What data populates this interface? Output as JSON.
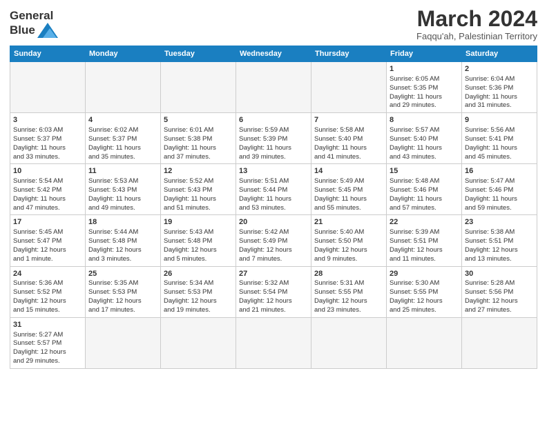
{
  "header": {
    "logo_text_general": "General",
    "logo_text_blue": "Blue",
    "month_title": "March 2024",
    "subtitle": "Faqqu'ah, Palestinian Territory"
  },
  "days_of_week": [
    "Sunday",
    "Monday",
    "Tuesday",
    "Wednesday",
    "Thursday",
    "Friday",
    "Saturday"
  ],
  "weeks": [
    [
      {
        "day": "",
        "info": "",
        "empty": true
      },
      {
        "day": "",
        "info": "",
        "empty": true
      },
      {
        "day": "",
        "info": "",
        "empty": true
      },
      {
        "day": "",
        "info": "",
        "empty": true
      },
      {
        "day": "",
        "info": "",
        "empty": true
      },
      {
        "day": "1",
        "info": "Sunrise: 6:05 AM\nSunset: 5:35 PM\nDaylight: 11 hours\nand 29 minutes.",
        "empty": false
      },
      {
        "day": "2",
        "info": "Sunrise: 6:04 AM\nSunset: 5:36 PM\nDaylight: 11 hours\nand 31 minutes.",
        "empty": false
      }
    ],
    [
      {
        "day": "3",
        "info": "Sunrise: 6:03 AM\nSunset: 5:37 PM\nDaylight: 11 hours\nand 33 minutes.",
        "empty": false
      },
      {
        "day": "4",
        "info": "Sunrise: 6:02 AM\nSunset: 5:37 PM\nDaylight: 11 hours\nand 35 minutes.",
        "empty": false
      },
      {
        "day": "5",
        "info": "Sunrise: 6:01 AM\nSunset: 5:38 PM\nDaylight: 11 hours\nand 37 minutes.",
        "empty": false
      },
      {
        "day": "6",
        "info": "Sunrise: 5:59 AM\nSunset: 5:39 PM\nDaylight: 11 hours\nand 39 minutes.",
        "empty": false
      },
      {
        "day": "7",
        "info": "Sunrise: 5:58 AM\nSunset: 5:40 PM\nDaylight: 11 hours\nand 41 minutes.",
        "empty": false
      },
      {
        "day": "8",
        "info": "Sunrise: 5:57 AM\nSunset: 5:40 PM\nDaylight: 11 hours\nand 43 minutes.",
        "empty": false
      },
      {
        "day": "9",
        "info": "Sunrise: 5:56 AM\nSunset: 5:41 PM\nDaylight: 11 hours\nand 45 minutes.",
        "empty": false
      }
    ],
    [
      {
        "day": "10",
        "info": "Sunrise: 5:54 AM\nSunset: 5:42 PM\nDaylight: 11 hours\nand 47 minutes.",
        "empty": false
      },
      {
        "day": "11",
        "info": "Sunrise: 5:53 AM\nSunset: 5:43 PM\nDaylight: 11 hours\nand 49 minutes.",
        "empty": false
      },
      {
        "day": "12",
        "info": "Sunrise: 5:52 AM\nSunset: 5:43 PM\nDaylight: 11 hours\nand 51 minutes.",
        "empty": false
      },
      {
        "day": "13",
        "info": "Sunrise: 5:51 AM\nSunset: 5:44 PM\nDaylight: 11 hours\nand 53 minutes.",
        "empty": false
      },
      {
        "day": "14",
        "info": "Sunrise: 5:49 AM\nSunset: 5:45 PM\nDaylight: 11 hours\nand 55 minutes.",
        "empty": false
      },
      {
        "day": "15",
        "info": "Sunrise: 5:48 AM\nSunset: 5:46 PM\nDaylight: 11 hours\nand 57 minutes.",
        "empty": false
      },
      {
        "day": "16",
        "info": "Sunrise: 5:47 AM\nSunset: 5:46 PM\nDaylight: 11 hours\nand 59 minutes.",
        "empty": false
      }
    ],
    [
      {
        "day": "17",
        "info": "Sunrise: 5:45 AM\nSunset: 5:47 PM\nDaylight: 12 hours\nand 1 minute.",
        "empty": false
      },
      {
        "day": "18",
        "info": "Sunrise: 5:44 AM\nSunset: 5:48 PM\nDaylight: 12 hours\nand 3 minutes.",
        "empty": false
      },
      {
        "day": "19",
        "info": "Sunrise: 5:43 AM\nSunset: 5:48 PM\nDaylight: 12 hours\nand 5 minutes.",
        "empty": false
      },
      {
        "day": "20",
        "info": "Sunrise: 5:42 AM\nSunset: 5:49 PM\nDaylight: 12 hours\nand 7 minutes.",
        "empty": false
      },
      {
        "day": "21",
        "info": "Sunrise: 5:40 AM\nSunset: 5:50 PM\nDaylight: 12 hours\nand 9 minutes.",
        "empty": false
      },
      {
        "day": "22",
        "info": "Sunrise: 5:39 AM\nSunset: 5:51 PM\nDaylight: 12 hours\nand 11 minutes.",
        "empty": false
      },
      {
        "day": "23",
        "info": "Sunrise: 5:38 AM\nSunset: 5:51 PM\nDaylight: 12 hours\nand 13 minutes.",
        "empty": false
      }
    ],
    [
      {
        "day": "24",
        "info": "Sunrise: 5:36 AM\nSunset: 5:52 PM\nDaylight: 12 hours\nand 15 minutes.",
        "empty": false
      },
      {
        "day": "25",
        "info": "Sunrise: 5:35 AM\nSunset: 5:53 PM\nDaylight: 12 hours\nand 17 minutes.",
        "empty": false
      },
      {
        "day": "26",
        "info": "Sunrise: 5:34 AM\nSunset: 5:53 PM\nDaylight: 12 hours\nand 19 minutes.",
        "empty": false
      },
      {
        "day": "27",
        "info": "Sunrise: 5:32 AM\nSunset: 5:54 PM\nDaylight: 12 hours\nand 21 minutes.",
        "empty": false
      },
      {
        "day": "28",
        "info": "Sunrise: 5:31 AM\nSunset: 5:55 PM\nDaylight: 12 hours\nand 23 minutes.",
        "empty": false
      },
      {
        "day": "29",
        "info": "Sunrise: 5:30 AM\nSunset: 5:55 PM\nDaylight: 12 hours\nand 25 minutes.",
        "empty": false
      },
      {
        "day": "30",
        "info": "Sunrise: 5:28 AM\nSunset: 5:56 PM\nDaylight: 12 hours\nand 27 minutes.",
        "empty": false
      }
    ],
    [
      {
        "day": "31",
        "info": "Sunrise: 5:27 AM\nSunset: 5:57 PM\nDaylight: 12 hours\nand 29 minutes.",
        "empty": false
      },
      {
        "day": "",
        "info": "",
        "empty": true
      },
      {
        "day": "",
        "info": "",
        "empty": true
      },
      {
        "day": "",
        "info": "",
        "empty": true
      },
      {
        "day": "",
        "info": "",
        "empty": true
      },
      {
        "day": "",
        "info": "",
        "empty": true
      },
      {
        "day": "",
        "info": "",
        "empty": true
      }
    ]
  ]
}
